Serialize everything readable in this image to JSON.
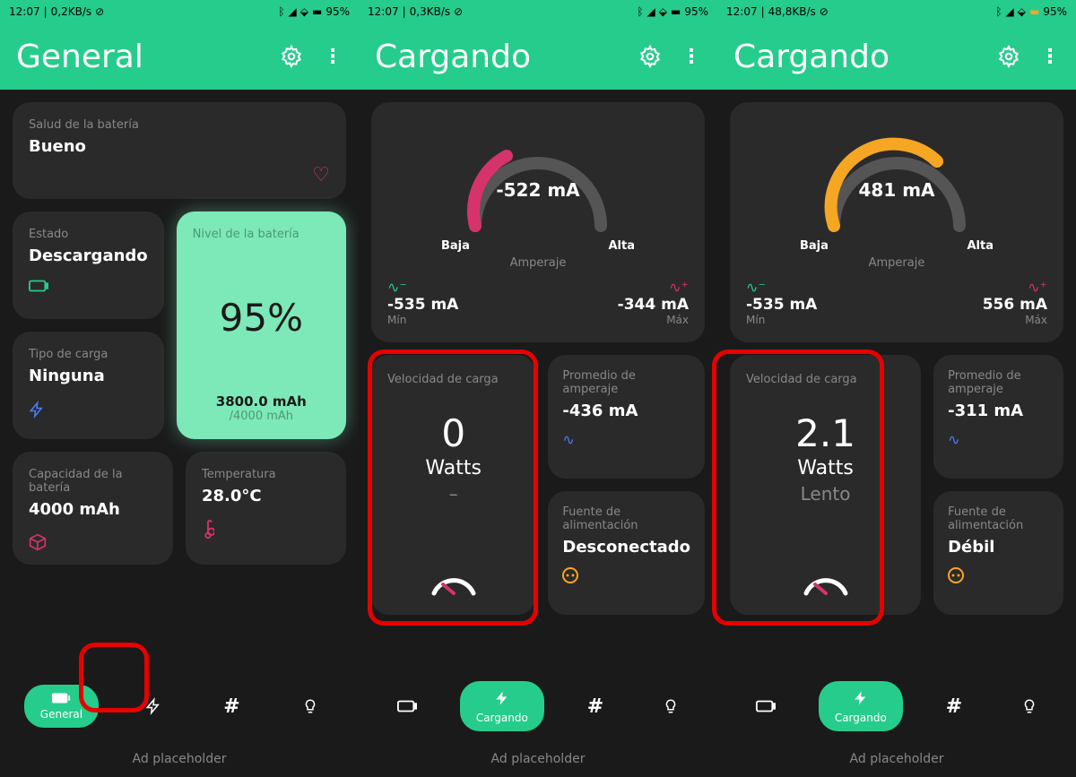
{
  "screens": [
    {
      "status": {
        "time": "12:07",
        "net": "0,2KB/s",
        "battery": "95%"
      },
      "title": "General",
      "health": {
        "label": "Salud de la batería",
        "value": "Bueno"
      },
      "state": {
        "label": "Estado",
        "value": "Descargando"
      },
      "level": {
        "label": "Nivel de la batería",
        "pct": "95%",
        "mah": "3800.0 mAh",
        "total": "/4000 mAh"
      },
      "chargeType": {
        "label": "Tipo de carga",
        "value": "Ninguna"
      },
      "capacity": {
        "label": "Capacidad de la batería",
        "value": "4000 mAh"
      },
      "temp": {
        "label": "Temperatura",
        "value": "28.0°C"
      },
      "nav": {
        "active": "General",
        "items": [
          "General",
          "",
          "",
          ""
        ]
      },
      "ad": "Ad placeholder"
    },
    {
      "status": {
        "time": "12:07",
        "net": "0,3KB/s",
        "battery": "95%"
      },
      "title": "Cargando",
      "gauge": {
        "value": "-522 mA",
        "low": "Baja",
        "high": "Alta",
        "name": "Amperaje",
        "color": "#d6336c"
      },
      "min": {
        "value": "-535 mA",
        "label": "Mín"
      },
      "max": {
        "value": "-344 mA",
        "label": "Máx"
      },
      "speed": {
        "label": "Velocidad de carga",
        "value": "0",
        "unit": "Watts",
        "rating": "–"
      },
      "avg": {
        "label": "Promedio de amperaje",
        "value": "-436 mA"
      },
      "source": {
        "label": "Fuente de alimentación",
        "value": "Desconectado"
      },
      "nav": {
        "active": "Cargando"
      },
      "ad": "Ad placeholder"
    },
    {
      "status": {
        "time": "12:07",
        "net": "48,8KB/s",
        "battery": "95%"
      },
      "title": "Cargando",
      "gauge": {
        "value": "481 mA",
        "low": "Baja",
        "high": "Alta",
        "name": "Amperaje",
        "color": "#f5a623"
      },
      "min": {
        "value": "-535 mA",
        "label": "Mín"
      },
      "max": {
        "value": "556 mA",
        "label": "Máx"
      },
      "speed": {
        "label": "Velocidad de carga",
        "value": "2.1",
        "unit": "Watts",
        "rating": "Lento"
      },
      "avg": {
        "label": "Promedio de amperaje",
        "value": "-311 mA"
      },
      "source": {
        "label": "Fuente de alimentación",
        "value": "Débil"
      },
      "nav": {
        "active": "Cargando"
      },
      "ad": "Ad placeholder"
    }
  ]
}
